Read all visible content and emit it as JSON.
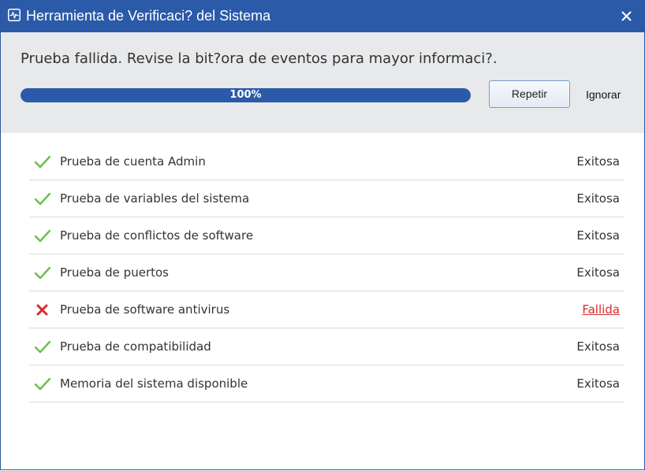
{
  "window": {
    "title": "Herramienta de Verificaci? del Sistema",
    "title_icon": "heartbeat-monitor-icon",
    "close_icon": "close-icon"
  },
  "header": {
    "status_message": "Prueba fallida. Revise la bit?ora de eventos para mayor informaci?.",
    "progress": {
      "value": 1.0,
      "label": "100%"
    },
    "repeat_label": "Repetir",
    "ignore_label": "Ignorar"
  },
  "tests": [
    {
      "name": "Prueba de cuenta Admin",
      "status": "Exitosa",
      "result": "pass",
      "icon": "check-icon"
    },
    {
      "name": "Prueba de variables del sistema",
      "status": "Exitosa",
      "result": "pass",
      "icon": "check-icon"
    },
    {
      "name": "Prueba de conflictos de software",
      "status": "Exitosa",
      "result": "pass",
      "icon": "check-icon"
    },
    {
      "name": "Prueba de puertos",
      "status": "Exitosa",
      "result": "pass",
      "icon": "check-icon"
    },
    {
      "name": "Prueba de software antivirus",
      "status": "Fallida",
      "result": "fail",
      "icon": "cross-icon"
    },
    {
      "name": "Prueba de compatibilidad",
      "status": "Exitosa",
      "result": "pass",
      "icon": "check-icon"
    },
    {
      "name": "Memoria del sistema disponible",
      "status": "Exitosa",
      "result": "pass",
      "icon": "check-icon"
    }
  ],
  "colors": {
    "titlebar": "#2b5aa8",
    "progress_fill": "#2b5aa8",
    "pass_icon": "#6abf4b",
    "fail": "#d92b2b"
  }
}
